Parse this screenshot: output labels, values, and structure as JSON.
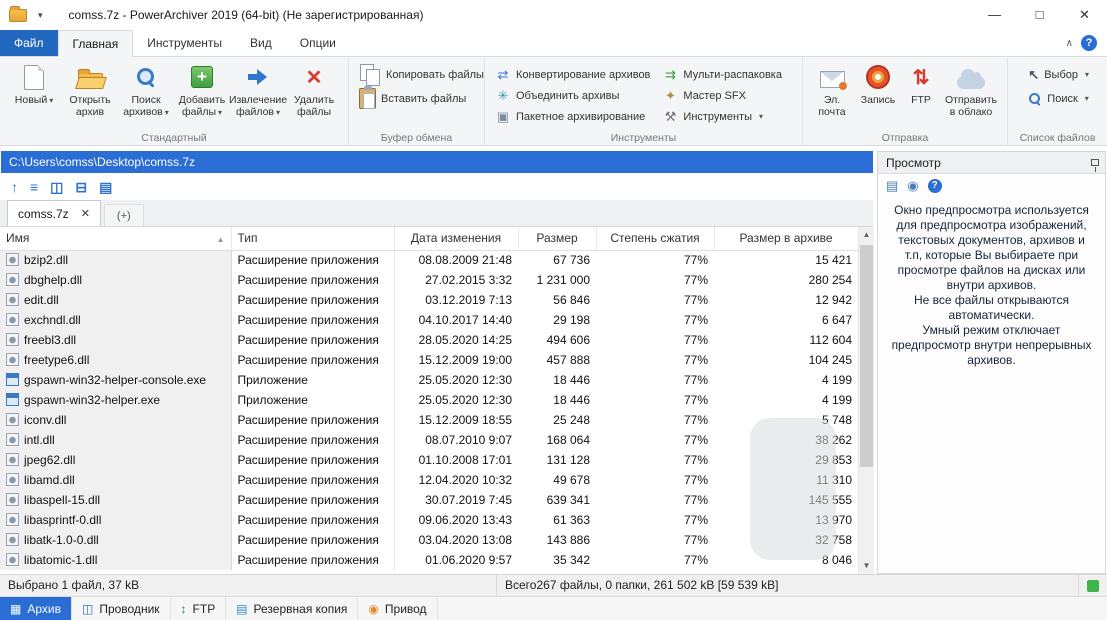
{
  "colors": {
    "accent": "#2a6dd5",
    "file_tab": "#2268c0",
    "status_green": "#3cb54a"
  },
  "titlebar": {
    "title": "comss.7z - PowerArchiver 2019 (64-bit) (Не зарегистрированная)",
    "minimize": "—",
    "maximize": "□",
    "close": "✕"
  },
  "tabs": {
    "file": "Файл",
    "home": "Главная",
    "tools": "Инструменты",
    "view": "Вид",
    "options": "Опции",
    "help": "?"
  },
  "ribbon": {
    "standard": {
      "label": "Стандартный",
      "new": "Новый",
      "open": "Открыть архив",
      "search": "Поиск архивов",
      "add": "Добавить файлы",
      "extract": "Извлечение файлов",
      "delete": "Удалить файлы"
    },
    "clipboard": {
      "label": "Буфер обмена",
      "copy": "Копировать файлы",
      "paste": "Вставить файлы"
    },
    "tools": {
      "label": "Инструменты",
      "convert": "Конвертирование архивов",
      "merge": "Объединить архивы",
      "batch": "Пакетное архивирование",
      "multi": "Мульти-распаковка",
      "sfx": "Мастер SFX",
      "tools_btn": "Инструменты"
    },
    "send": {
      "label": "Отправка",
      "email": "Эл. почта",
      "burn": "Запись",
      "ftp": "FTP",
      "cloud": "Отправить в облако"
    },
    "filelist": {
      "label": "Список файлов",
      "select": "Выбор",
      "search": "Поиск"
    }
  },
  "address": {
    "path": "C:\\Users\\comss\\Desktop\\comss.7z"
  },
  "tabstrip": {
    "archive_tab": "comss.7z",
    "new_tab": "(+)"
  },
  "preview": {
    "title": "Просмотр",
    "text1": "Окно предпросмотра используется для предпросмотра изображений, текстовых документов, архивов и т.п, которые Вы выбираете при просмотре файлов на дисках или внутри архивов.",
    "text2": "Не все файлы открываются автоматически.",
    "text3": "Умный режим отключает предпросмотр внутри непрерывных архивов."
  },
  "table": {
    "columns": [
      "Имя",
      "Тип",
      "Дата изменения",
      "Размер",
      "Степень сжатия",
      "Размер в архиве"
    ],
    "rows": [
      {
        "name": "bzip2.dll",
        "type": "Расширение приложения",
        "date": "08.08.2009 21:48",
        "size": "67 736",
        "ratio": "77%",
        "packed": "15 421",
        "icon": "dll"
      },
      {
        "name": "dbghelp.dll",
        "type": "Расширение приложения",
        "date": "27.02.2015 3:32",
        "size": "1 231 000",
        "ratio": "77%",
        "packed": "280 254",
        "icon": "dll"
      },
      {
        "name": "edit.dll",
        "type": "Расширение приложения",
        "date": "03.12.2019 7:13",
        "size": "56 846",
        "ratio": "77%",
        "packed": "12 942",
        "icon": "dll"
      },
      {
        "name": "exchndl.dll",
        "type": "Расширение приложения",
        "date": "04.10.2017 14:40",
        "size": "29 198",
        "ratio": "77%",
        "packed": "6 647",
        "icon": "dll"
      },
      {
        "name": "freebl3.dll",
        "type": "Расширение приложения",
        "date": "28.05.2020 14:25",
        "size": "494 606",
        "ratio": "77%",
        "packed": "112 604",
        "icon": "dll"
      },
      {
        "name": "freetype6.dll",
        "type": "Расширение приложения",
        "date": "15.12.2009 19:00",
        "size": "457 888",
        "ratio": "77%",
        "packed": "104 245",
        "icon": "dll"
      },
      {
        "name": "gspawn-win32-helper-console.exe",
        "type": "Приложение",
        "date": "25.05.2020 12:30",
        "size": "18 446",
        "ratio": "77%",
        "packed": "4 199",
        "icon": "exe"
      },
      {
        "name": "gspawn-win32-helper.exe",
        "type": "Приложение",
        "date": "25.05.2020 12:30",
        "size": "18 446",
        "ratio": "77%",
        "packed": "4 199",
        "icon": "exe"
      },
      {
        "name": "iconv.dll",
        "type": "Расширение приложения",
        "date": "15.12.2009 18:55",
        "size": "25 248",
        "ratio": "77%",
        "packed": "5 748",
        "icon": "dll"
      },
      {
        "name": "intl.dll",
        "type": "Расширение приложения",
        "date": "08.07.2010 9:07",
        "size": "168 064",
        "ratio": "77%",
        "packed": "38 262",
        "icon": "dll"
      },
      {
        "name": "jpeg62.dll",
        "type": "Расширение приложения",
        "date": "01.10.2008 17:01",
        "size": "131 128",
        "ratio": "77%",
        "packed": "29 853",
        "icon": "dll"
      },
      {
        "name": "libamd.dll",
        "type": "Расширение приложения",
        "date": "12.04.2020 10:32",
        "size": "49 678",
        "ratio": "77%",
        "packed": "11 310",
        "icon": "dll"
      },
      {
        "name": "libaspell-15.dll",
        "type": "Расширение приложения",
        "date": "30.07.2019 7:45",
        "size": "639 341",
        "ratio": "77%",
        "packed": "145 555",
        "icon": "dll"
      },
      {
        "name": "libasprintf-0.dll",
        "type": "Расширение приложения",
        "date": "09.06.2020 13:43",
        "size": "61 363",
        "ratio": "77%",
        "packed": "13 970",
        "icon": "dll"
      },
      {
        "name": "libatk-1.0-0.dll",
        "type": "Расширение приложения",
        "date": "03.04.2020 13:08",
        "size": "143 886",
        "ratio": "77%",
        "packed": "32 758",
        "icon": "dll"
      },
      {
        "name": "libatomic-1.dll",
        "type": "Расширение приложения",
        "date": "01.06.2020 9:57",
        "size": "35 342",
        "ratio": "77%",
        "packed": "8 046",
        "icon": "dll"
      }
    ]
  },
  "statusbar": {
    "selected": "Выбрано 1 файл, 37 kB",
    "total": "Всего267 файлы, 0 папки, 261 502 kB [59 539 kB]"
  },
  "bottom_tabs": {
    "archive": "Архив",
    "explorer": "Проводник",
    "ftp": "FTP",
    "backup": "Резервная копия",
    "drive": "Привод"
  }
}
